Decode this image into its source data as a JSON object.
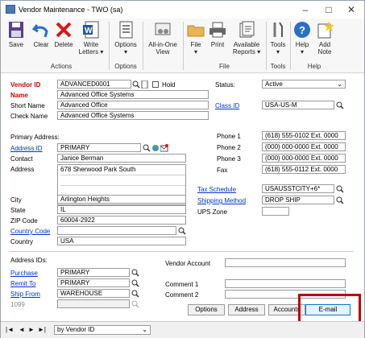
{
  "window": {
    "title": "Vendor Maintenance  -  TWO (sa)"
  },
  "ribbon": {
    "buttons": [
      {
        "label": "Save",
        "icon": "floppy-disk-icon"
      },
      {
        "label": "Clear",
        "icon": "undo-arrow-icon"
      },
      {
        "label": "Delete",
        "icon": "red-x-icon"
      },
      {
        "label": "Write",
        "label2": "Letters",
        "icon": "word-document-icon"
      },
      {
        "label": "Options",
        "icon": "options-list-icon"
      },
      {
        "label": "All-in-One",
        "label2": "View",
        "icon": "all-in-one-view-icon"
      },
      {
        "label": "File",
        "icon": "folder-icon"
      },
      {
        "label": "Print",
        "icon": "printer-icon"
      },
      {
        "label": "Available",
        "label2": "Reports",
        "icon": "reports-icon"
      },
      {
        "label": "Tools",
        "icon": "tools-icon"
      },
      {
        "label": "Help",
        "icon": "help-icon"
      },
      {
        "label": "Add",
        "label2": "Note",
        "icon": "add-note-icon"
      }
    ],
    "groups": [
      "Actions",
      "Options",
      "File",
      "Tools",
      "Help"
    ]
  },
  "vendor": {
    "id_label": "Vendor ID",
    "id": "ADVANCED0001",
    "hold_label": "Hold",
    "name_label": "Name",
    "name": "Advanced Office Systems",
    "short_label": "Short Name",
    "short": "Advanced Office",
    "check_label": "Check Name",
    "check": "Advanced Office Systems",
    "status_label": "Status:",
    "status": "Active",
    "class_label": "Class ID",
    "class": "USA-US-M"
  },
  "address": {
    "primary_label": "Primary Address:",
    "id_label": "Address ID",
    "id": "PRIMARY",
    "contact_label": "Contact",
    "contact": "Janice Berman",
    "address_label": "Address",
    "address": "678 Sherwood Park South",
    "city_label": "City",
    "city": "Arlington Heights",
    "state_label": "State",
    "state": "IL",
    "zip_label": "ZIP Code",
    "zip": "60004-2922",
    "country_code_label": "Country Code",
    "country_code": "",
    "country_label": "Country",
    "country": "USA"
  },
  "phones": {
    "phone1_label": "Phone 1",
    "phone1": "(618) 555-0102  Ext. 0000",
    "phone2_label": "Phone 2",
    "phone2": "(000) 000-0000  Ext. 0000",
    "phone3_label": "Phone 3",
    "phone3": "(000) 000-0000  Ext. 0000",
    "fax_label": "Fax",
    "fax": "(618) 555-0112  Ext. 0000"
  },
  "tax": {
    "schedule_label": "Tax Schedule",
    "schedule": "USAUSSTCITY+6*",
    "shipping_label": "Shipping Method",
    "shipping": "DROP SHIP",
    "ups_label": "UPS Zone",
    "ups": ""
  },
  "address_ids": {
    "header": "Address IDs:",
    "purchase_label": "Purchase",
    "purchase": "PRIMARY",
    "remit_label": "Remit To",
    "remit": "PRIMARY",
    "ship_label": "Ship From",
    "ship": "WAREHOUSE",
    "form_label": "1099",
    "form": ""
  },
  "account": {
    "vendor_account_label": "Vendor Account",
    "vendor_account": "",
    "comment1_label": "Comment 1",
    "comment1": "",
    "comment2_label": "Comment 2",
    "comment2": ""
  },
  "bottom_buttons": [
    "Options",
    "Address",
    "Accounts",
    "E-mail"
  ],
  "statusbar": {
    "sort": "by Vendor ID",
    "nav": [
      "|◄",
      "◄",
      "►",
      "►|"
    ]
  }
}
